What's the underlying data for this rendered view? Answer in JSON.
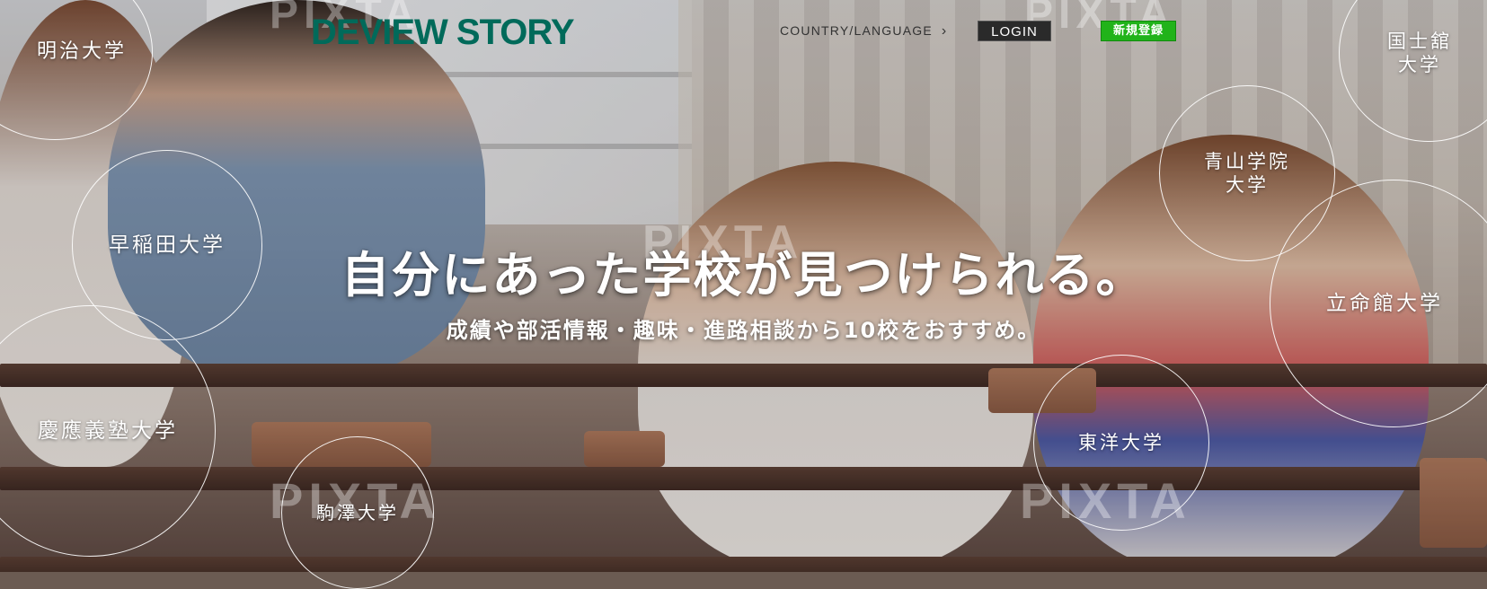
{
  "header": {
    "logo_text": "DEVIEW STORY",
    "country_language": "COUNTRY/LANGUAGE",
    "login_label": "LOGIN",
    "register_label": "新規登録"
  },
  "hero": {
    "headline": "自分にあった学校が見つけられる。",
    "subline": "成績や部活情報・趣味・進路相談から10校をおすすめ。",
    "watermark": "PIXTA"
  },
  "universities": [
    {
      "name": "明治大学"
    },
    {
      "name": "早稲田大学"
    },
    {
      "name": "慶應義塾大学"
    },
    {
      "name": "駒澤大学"
    },
    {
      "name": "国士舘\n大学"
    },
    {
      "name": "青山学院\n大学"
    },
    {
      "name": "立命館大学"
    },
    {
      "name": "東洋大学"
    }
  ],
  "colors": {
    "logo": "#006a5a",
    "register_button": "#21b31a",
    "login_button": "#2a2a2a"
  },
  "icons": {
    "country_chevron": "chevron-right-icon"
  }
}
